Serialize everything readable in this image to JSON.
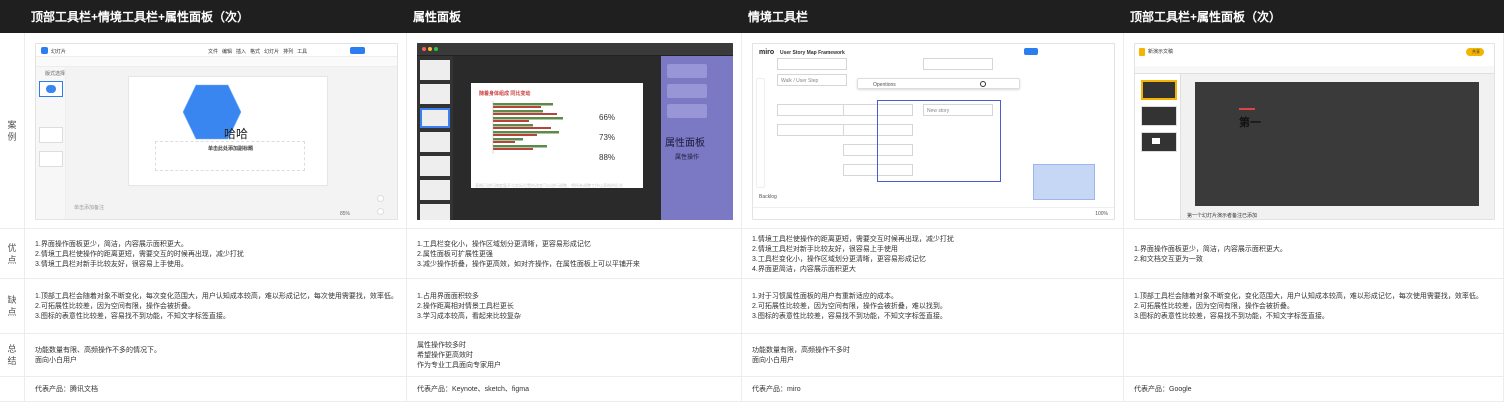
{
  "headers": {
    "col1": "顶部工具栏+情境工具栏+属性面板（次）",
    "col2": "属性面板",
    "col3": "情境工具栏",
    "col4": "顶部工具栏+属性面板（次）"
  },
  "row_labels": {
    "case": "案例",
    "pros": "优点",
    "cons": "缺点",
    "summary": "总结",
    "product": ""
  },
  "cells": {
    "pros": [
      "1.界面操作面板更少，简洁，内容展示面积更大。\n2.情境工具栏使操作的距离更短，需要交互的时候再出现，减少打扰\n3.情境工具栏对新手比较友好，很容易上手使用。",
      "1.工具栏变化小，操作区域划分更清晰，更容易形成记忆\n2.属性面板可扩展性更强\n3.减少操作折叠，操作更高效，如对齐操作，在属性面板上可以平铺开来",
      "1.情境工具栏使操作的距离更短，需要交互时候再出现，减少打扰\n2.情境工具栏对新手比较友好，很容易上手使用\n3.工具栏变化小，操作区域划分更清晰，更容易形成记忆\n4.界面更简洁，内容展示面积更大",
      "1.界面操作面板更少，简洁，内容展示面积更大。\n2.和文档交互更为一致"
    ],
    "cons": [
      "1.顶部工具栏会随着对象不断变化，每次变化范围大，用户认知成本较高，难以形成记忆，每次使用需要找，效率低。\n2.可拓展性比较差，因为空间有限，操作会被折叠。\n3.图标的表意性比较差，容易找不到功能，不知文字标签直接。",
      "1.占用界面面积较多\n2.操作距离相对情景工具栏更长\n3.学习成本较高，看起来比较复杂",
      "1.对于习惯属性面板的用户有重新适应的成本。\n2.可拓展性比较差，因为空间有限，操作会被折叠，难以找到。\n3.图标的表意性比较差，容易找不到功能，不知文字标签直接。",
      "1.顶部工具栏会随着对象不断变化，变化范围大，用户认知成本较高，难以形成记忆，每次使用需要找，效率低。\n2.可拓展性比较差，因为空间有限，操作会被折叠。\n3.图标的表意性比较差，容易找不到功能，不知文字标签直接。"
    ],
    "summary": [
      "功能数量有限、高频操作不多的情况下。\n面向小白用户",
      "属性操作较多时\n希望操作更高效时\n作为专业工具面向专家用户",
      "功能数量有限，高频操作不多时\n面向小白用户",
      ""
    ],
    "product": [
      "代表产品：腾讯文档",
      "代表产品：Keynote、sketch、figma",
      "代表产品：miro",
      "代表产品：Google"
    ]
  },
  "screens": {
    "s1": {
      "app_name": "幻灯片",
      "menu": [
        "文件",
        "编辑",
        "插入",
        "格式",
        "幻灯片",
        "排列",
        "工具"
      ],
      "share": "分享",
      "layout_btn": "版式选择",
      "slide_text": "哈哈",
      "subtitle": "单击此处添加副标题",
      "notes": "单击添加备注",
      "zoom": "85%"
    },
    "s2": {
      "chart_title": "随着身体组成 同比变动",
      "sidebar_title": "属性面板",
      "sidebar_sub": "属性操作",
      "stats": [
        "66%",
        "73%",
        "88%"
      ],
      "caption": "表格已进行跨度展开与实际位置的改变可以进行调整，将所有调整工作以表格的形式"
    },
    "s3": {
      "logo": "miro",
      "board_title": "User Story Map Framework",
      "share": "Share",
      "dropdown": "Opentions",
      "sticky": "New story",
      "row1": "Walk / User Step",
      "bottom_label": "Backlog",
      "zoom": "100%"
    },
    "s4": {
      "title": "新演示文稿",
      "share": "共享",
      "slide_word": "第一",
      "notes": "第一个幻灯片演示者备注已添加"
    }
  },
  "colors": {
    "header_bg": "#1f1f1f",
    "accent_blue": "#2b7df0",
    "hexagon": "#3a86f0",
    "keynote_sidebar": "#7b78c4",
    "chart_green": "#5c8a4a",
    "chart_red": "#b8433a"
  }
}
